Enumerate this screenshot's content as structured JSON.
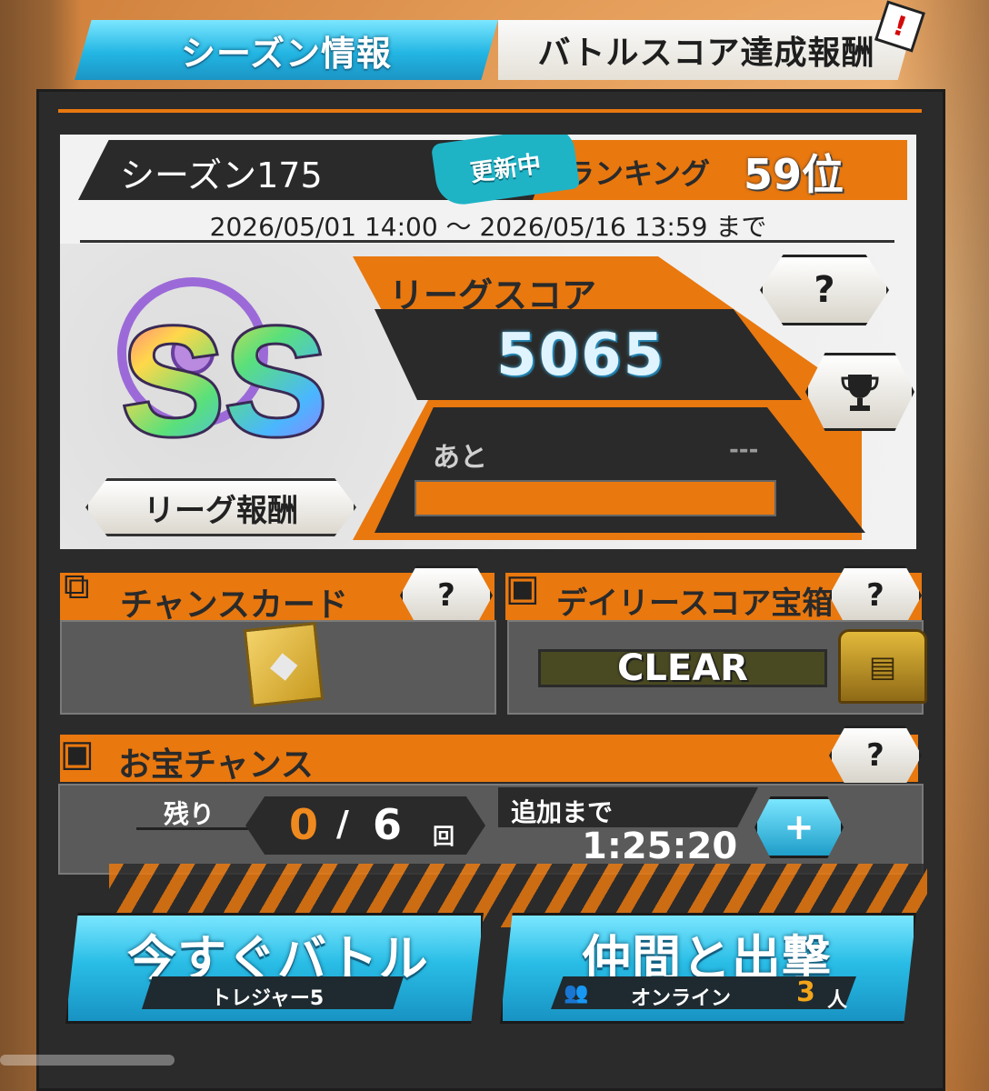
{
  "tabs": {
    "season_info": "シーズン情報",
    "battle_score_rewards": "バトルスコア達成報酬",
    "alert_badge": "!"
  },
  "season": {
    "title": "シーズン175",
    "updating_badge": "更新中",
    "ranking_label": "ランキング",
    "ranking_value": "59位",
    "date_range": "2026/05/01 14:00 ～ 2026/05/16 13:59 まで"
  },
  "league": {
    "rank_emblem": "SS",
    "reward_button": "リーグ報酬",
    "score_label": "リーグスコア",
    "score_value": "5065",
    "remaining_label": "あと",
    "remaining_value": "---",
    "progress_fill_pct": 100,
    "help_button": "?",
    "trophy_icon": "trophy-icon"
  },
  "chance_card": {
    "title": "チャンスカード",
    "help_button": "?",
    "icon": "card-icon"
  },
  "daily_score_chest": {
    "title": "デイリースコア宝箱",
    "help_button": "?",
    "status": "CLEAR",
    "icon": "chest-icon"
  },
  "treasure_chance": {
    "title": "お宝チャンス",
    "help_button": "?",
    "remaining_label": "残り",
    "current": "0",
    "slash": "/",
    "total": "6",
    "unit": "回",
    "add_label": "追加まで",
    "timer": "1:25:20",
    "plus_button": "+"
  },
  "battle_now": {
    "label": "今すぐバトル",
    "sub_label": "トレジャー5"
  },
  "team_sortie": {
    "label": "仲間と出撃",
    "online_label": "オンライン",
    "online_count": "3",
    "online_unit": "人"
  },
  "colors": {
    "accent_orange": "#e9780f",
    "accent_cyan": "#29bde6",
    "panel_dark": "#2b2b2b"
  }
}
